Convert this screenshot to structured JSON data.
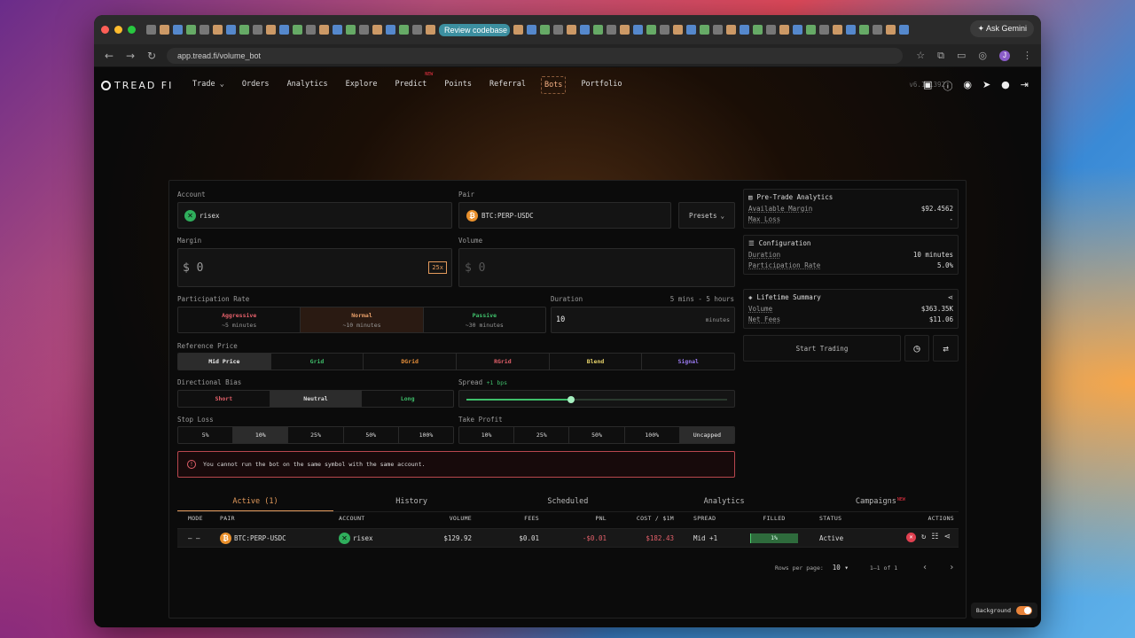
{
  "browser": {
    "active_tab_title": "Review codebase an",
    "url": "app.tread.fi/volume_bot",
    "gemini_label": "Ask Gemini"
  },
  "nav": {
    "logo": "TREAD FI",
    "items": [
      {
        "label": "Trade",
        "chevron": true
      },
      {
        "label": "Orders"
      },
      {
        "label": "Analytics"
      },
      {
        "label": "Explore"
      },
      {
        "label": "Predict",
        "badge": "NEW"
      },
      {
        "label": "Points"
      },
      {
        "label": "Referral"
      },
      {
        "label": "Bots",
        "active": true
      },
      {
        "label": "Portfolio"
      }
    ],
    "version": "v6.1.1392"
  },
  "form": {
    "account_label": "Account",
    "account_value": "risex",
    "pair_label": "Pair",
    "pair_value": "BTC:PERP-USDC",
    "presets_label": "Presets",
    "margin_label": "Margin",
    "margin_value": "$ 0",
    "leverage": "25x",
    "volume_label": "Volume",
    "volume_value": "$ 0",
    "participation_label": "Participation Rate",
    "participation_options": [
      {
        "name": "Aggressive",
        "sub": "~5 minutes",
        "color": "#e3606a"
      },
      {
        "name": "Normal",
        "sub": "~10 minutes",
        "color": "#e9a06a",
        "selected": true
      },
      {
        "name": "Passive",
        "sub": "~30 minutes",
        "color": "#3fbf6b"
      }
    ],
    "duration_label": "Duration",
    "duration_range": "5 mins - 5 hours",
    "duration_value": "10",
    "duration_unit": "minutes",
    "reference_label": "Reference Price",
    "reference_options": [
      {
        "name": "Mid Price",
        "color": "#eeeeee",
        "selected": true
      },
      {
        "name": "Grid",
        "color": "#3fbf6b"
      },
      {
        "name": "DGrid",
        "color": "#e9903a"
      },
      {
        "name": "RGrid",
        "color": "#e3606a"
      },
      {
        "name": "Blend",
        "color": "#e8d46a"
      },
      {
        "name": "Signal",
        "color": "#9a7af0"
      }
    ],
    "bias_label": "Directional Bias",
    "bias_options": [
      {
        "name": "Short",
        "color": "#e3606a"
      },
      {
        "name": "Neutral",
        "color": "#dddddd",
        "selected": true
      },
      {
        "name": "Long",
        "color": "#3fbf6b"
      }
    ],
    "spread_label": "Spread",
    "spread_value": "+1 bps",
    "spread_position": 0.4,
    "stoploss_label": "Stop Loss",
    "stoploss_options": [
      {
        "name": "5%"
      },
      {
        "name": "10%",
        "selected": true
      },
      {
        "name": "25%"
      },
      {
        "name": "50%"
      },
      {
        "name": "100%"
      }
    ],
    "takeprofit_label": "Take Profit",
    "takeprofit_options": [
      {
        "name": "10%"
      },
      {
        "name": "25%"
      },
      {
        "name": "50%"
      },
      {
        "name": "100%"
      },
      {
        "name": "Uncapped",
        "selected": true
      }
    ],
    "error_message": "You cannot run the bot on the same symbol with the same account."
  },
  "sidebar": {
    "pretrade_title": "Pre-Trade Analytics",
    "available_margin_label": "Available Margin",
    "available_margin_value": "$92.4562",
    "max_loss_label": "Max Loss",
    "max_loss_value": "-",
    "config_title": "Configuration",
    "duration_label": "Duration",
    "duration_value": "10 minutes",
    "participation_label": "Participation Rate",
    "participation_value": "5.0%",
    "lifetime_title": "Lifetime Summary",
    "volume_label": "Volume",
    "volume_value": "$363.35K",
    "netfees_label": "Net Fees",
    "netfees_value": "$11.06",
    "start_label": "Start Trading"
  },
  "bottom_tabs": [
    {
      "label": "Active (1)",
      "active": true
    },
    {
      "label": "History"
    },
    {
      "label": "Scheduled"
    },
    {
      "label": "Analytics"
    },
    {
      "label": "Campaigns",
      "badge": "NEW"
    }
  ],
  "table": {
    "headers": [
      "MODE",
      "PAIR",
      "ACCOUNT",
      "VOLUME",
      "FEES",
      "PNL",
      "COST / $1M",
      "SPREAD",
      "FILLED",
      "STATUS",
      "ACTIONS"
    ],
    "rows": [
      {
        "mode": "— —",
        "pair": "BTC:PERP-USDC",
        "account": "risex",
        "volume": "$129.92",
        "fees": "$0.01",
        "pnl": "-$0.01",
        "cost": "$182.43",
        "spread": "Mid +1",
        "filled": "1%",
        "filled_fraction": 0.01,
        "status": "Active"
      }
    ]
  },
  "pagination": {
    "rows_label": "Rows per page:",
    "rows_value": "10",
    "range": "1–1 of 1"
  },
  "background_toggle_label": "Background",
  "colors": {
    "accent": "#e39a5c",
    "negative": "#e3606a",
    "positive": "#3fbf6b",
    "filled_bar": "#2e6b3c"
  }
}
